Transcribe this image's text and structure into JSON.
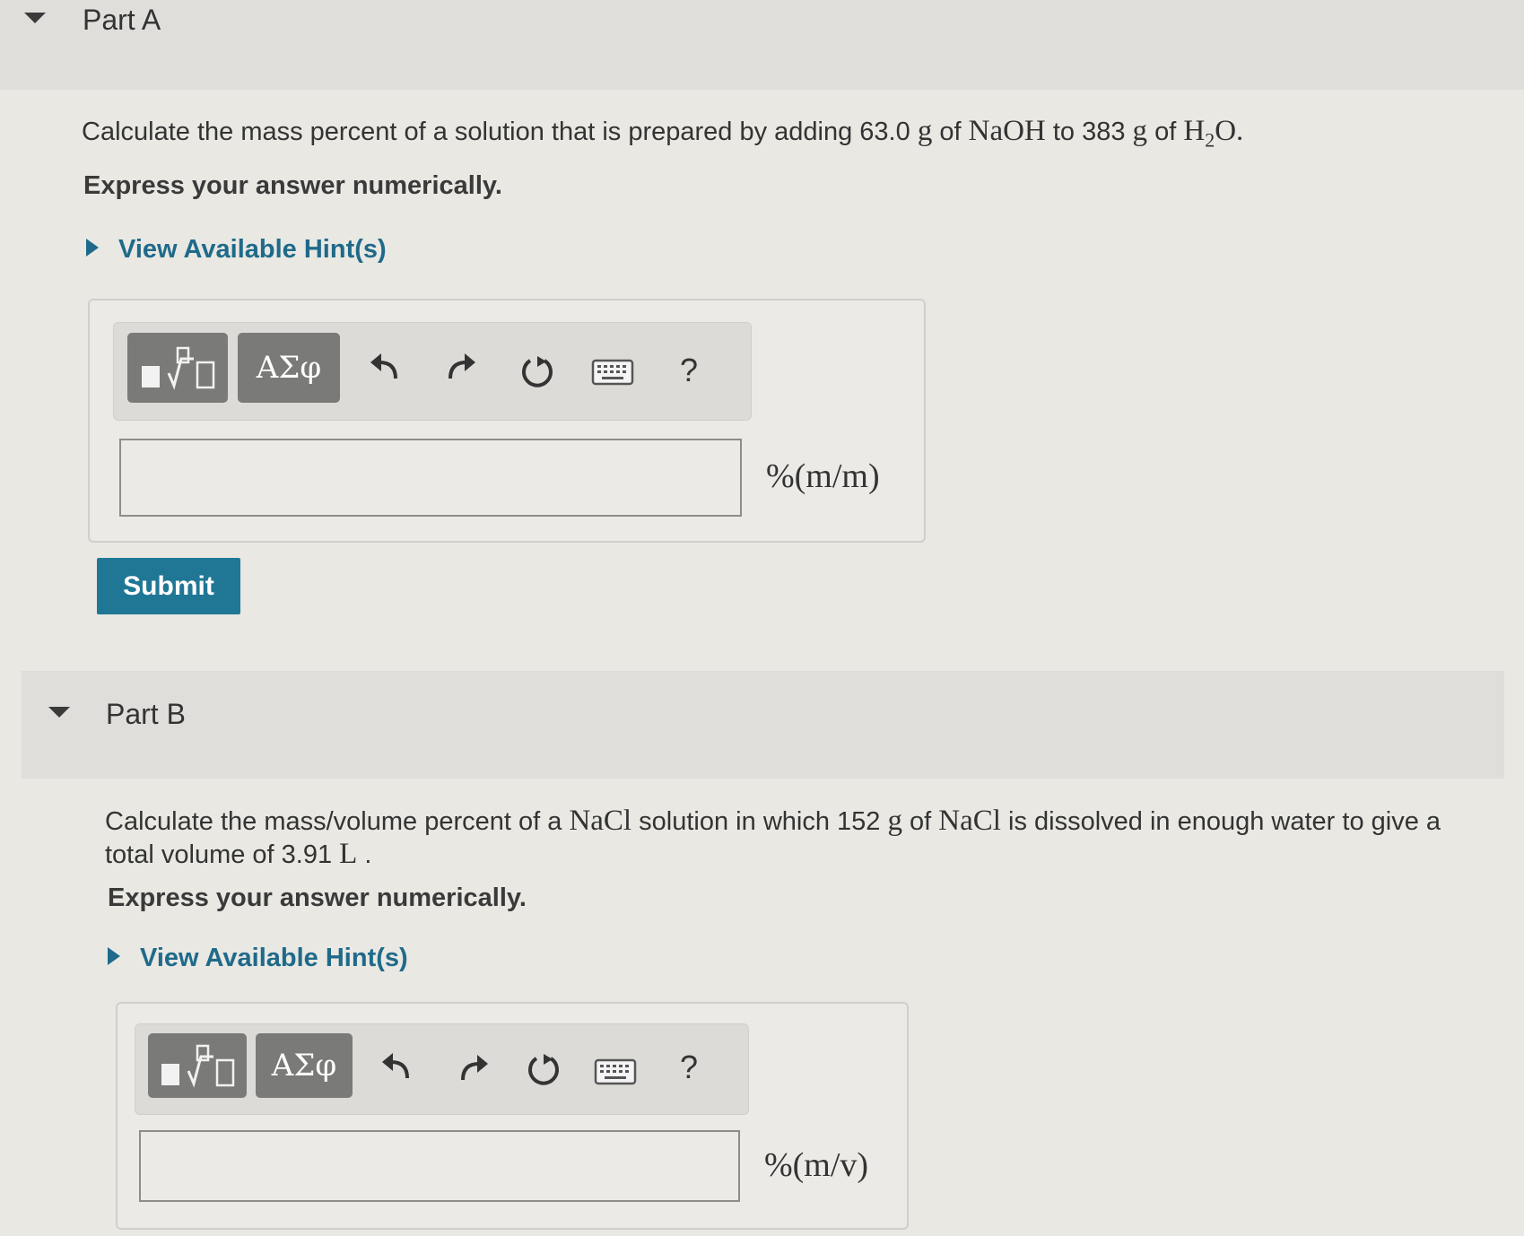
{
  "part_a": {
    "title": "Part A",
    "question_prefix": "Calculate the mass percent of a solution that is prepared by adding 63.0",
    "unit_g1": "g",
    "of1": "of",
    "naoh": "NaOH",
    "to": "to 383",
    "unit_g2": "g",
    "of2": "of",
    "h2o_h": "H",
    "h2o_sub": "2",
    "h2o_o": "O.",
    "instruction": "Express your answer numerically.",
    "hint": "View Available Hint(s)",
    "toolbar": {
      "greek_label": "ΑΣφ",
      "help_label": "?"
    },
    "input_value": "",
    "unit": "%(m/m)",
    "submit_label": "Submit"
  },
  "part_b": {
    "title": "Part B",
    "question_line1_a": "Calculate the mass/volume percent of a",
    "nacl1": "NaCl",
    "question_line1_b": "solution in which 152",
    "unit_g": "g",
    "of": "of",
    "nacl2": "NaCl",
    "question_line1_c": "is dissolved in enough water to give a",
    "question_line2_a": "total volume of 3.91",
    "unit_l": "L",
    "question_line2_b": ".",
    "instruction": "Express your answer numerically.",
    "hint": "View Available Hint(s)",
    "toolbar": {
      "greek_label": "ΑΣφ",
      "help_label": "?"
    },
    "input_value": "",
    "unit": "%(m/v)"
  }
}
